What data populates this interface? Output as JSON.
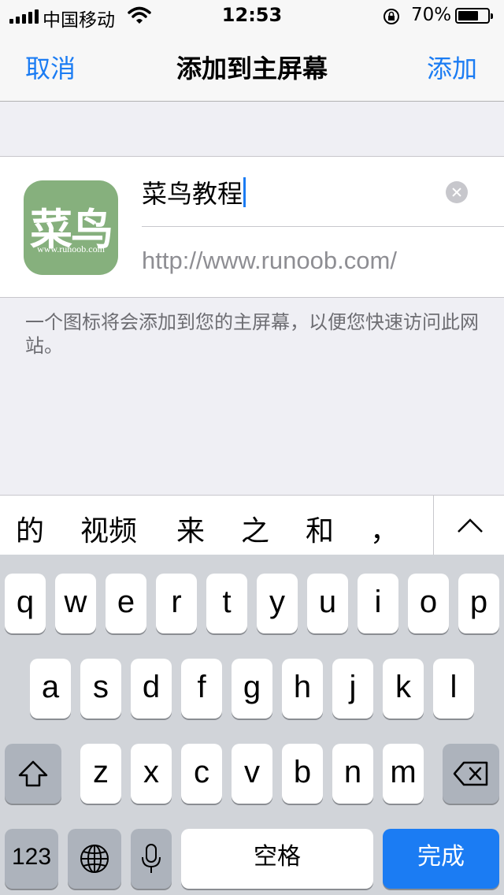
{
  "status_bar": {
    "carrier": "中国移动",
    "time": "12:53",
    "battery_percent": "70%",
    "battery_level": 0.7,
    "icons": [
      "signal-icon",
      "wifi-icon",
      "orientation-lock-icon",
      "battery-icon"
    ]
  },
  "nav": {
    "cancel_label": "取消",
    "title": "添加到主屏幕",
    "add_label": "添加"
  },
  "bookmark": {
    "icon_text": "菜鸟",
    "icon_url": "www.runoob.com",
    "name_value": "菜鸟教程",
    "url": "http://www.runoob.com/",
    "icon_color": "#86b07d"
  },
  "footer_note": "一个图标将会添加到您的主屏幕，以便您快速访问此网站。",
  "candidates": [
    "的",
    "视频",
    "来",
    "之",
    "和",
    "，"
  ],
  "keyboard": {
    "row1": [
      "q",
      "w",
      "e",
      "r",
      "t",
      "y",
      "u",
      "i",
      "o",
      "p"
    ],
    "row2": [
      "a",
      "s",
      "d",
      "f",
      "g",
      "h",
      "j",
      "k",
      "l"
    ],
    "row3": [
      "z",
      "x",
      "c",
      "v",
      "b",
      "n",
      "m"
    ],
    "num_label": "123",
    "space_label": "空格",
    "done_label": "完成"
  },
  "colors": {
    "accent": "#1b7cf3",
    "background": "#efeff4"
  }
}
